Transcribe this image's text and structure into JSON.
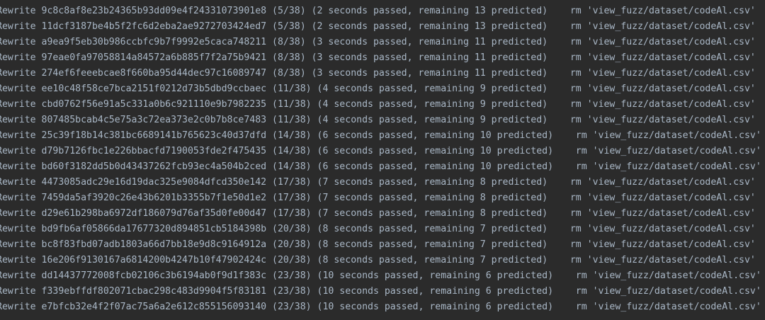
{
  "terminal": {
    "lines": [
      "Rewrite 9c8c8af8e23b24365b93dd09e4f24331073901e8 (5/38) (2 seconds passed, remaining 13 predicted)    rm 'view_fuzz/dataset/codeAl.csv'",
      "Rewrite 11dcf3187be4b5f2fc6d2eba2ae9272703424ed7 (5/38) (2 seconds passed, remaining 13 predicted)    rm 'view_fuzz/dataset/codeAl.csv'",
      "Rewrite a9ea9f5eb30b986ccbfc9b7f9992e5caca748211 (8/38) (3 seconds passed, remaining 11 predicted)    rm 'view_fuzz/dataset/codeAl.csv'",
      "Rewrite 97eae0fa97058814a84572a6b885f7f2a75b9421 (8/38) (3 seconds passed, remaining 11 predicted)    rm 'view_fuzz/dataset/codeAl.csv'",
      "Rewrite 274ef6feeebcae8f660ba95d44dec97c16089747 (8/38) (3 seconds passed, remaining 11 predicted)    rm 'view_fuzz/dataset/codeAl.csv'",
      "Rewrite ee10c48f58ce7bca2151f0212d73b5dbd9ccbaec (11/38) (4 seconds passed, remaining 9 predicted)    rm 'view_fuzz/dataset/codeAl.csv'",
      "Rewrite cbd0762f56e91a5c331a0b6c921110e9b7982235 (11/38) (4 seconds passed, remaining 9 predicted)    rm 'view_fuzz/dataset/codeAl.csv'",
      "Rewrite 807485bcab4c5e75a3c72ea373e2c0b7b8ce7483 (11/38) (4 seconds passed, remaining 9 predicted)    rm 'view_fuzz/dataset/codeAl.csv'",
      "Rewrite 25c39f18b14c381bc6689141b765623c40d37dfd (14/38) (6 seconds passed, remaining 10 predicted)    rm 'view_fuzz/dataset/codeAl.csv'",
      "Rewrite d79b7126fbc1e226bbacfd7190053fde2f475435 (14/38) (6 seconds passed, remaining 10 predicted)    rm 'view_fuzz/dataset/codeAl.csv'",
      "Rewrite bd60f3182dd5b0d43437262fcb93ec4a504b2ced (14/38) (6 seconds passed, remaining 10 predicted)    rm 'view_fuzz/dataset/codeAl.csv'",
      "Rewrite 4473085adc29e16d19dac325e9084dfcd350e142 (17/38) (7 seconds passed, remaining 8 predicted)    rm 'view_fuzz/dataset/codeAl.csv'",
      "Rewrite 7459da5af3920c26e43b6201b3355b7f1e50d1e2 (17/38) (7 seconds passed, remaining 8 predicted)    rm 'view_fuzz/dataset/codeAl.csv'",
      "Rewrite d29e61b298ba6972df186079d76af35d0fe00d47 (17/38) (7 seconds passed, remaining 8 predicted)    rm 'view_fuzz/dataset/codeAl.csv'",
      "Rewrite bd9fb6af05866da17677320d894851cb5184398b (20/38) (8 seconds passed, remaining 7 predicted)    rm 'view_fuzz/dataset/codeAl.csv'",
      "Rewrite bc8f83fbd07adb1803a66d7bb18e9d8c9164912a (20/38) (8 seconds passed, remaining 7 predicted)    rm 'view_fuzz/dataset/codeAl.csv'",
      "Rewrite 16e206f9130167a6814200b4247b10f47902424c (20/38) (8 seconds passed, remaining 7 predicted)    rm 'view_fuzz/dataset/codeAl.csv'",
      "Rewrite dd14437772008fcb02106c3b6194ab0f9d1f383c (23/38) (10 seconds passed, remaining 6 predicted)    rm 'view_fuzz/dataset/codeAl.csv'",
      "Rewrite f339ebffdf802071cbac298c483d9904f5f83181 (23/38) (10 seconds passed, remaining 6 predicted)    rm 'view_fuzz/dataset/codeAl.csv'",
      "Rewrite e7bfcb32e4f2f07ac75a6a2e612c855156093140 (23/38) (10 seconds passed, remaining 6 predicted)    rm 'view_fuzz/dataset/codeAl.csv'"
    ]
  },
  "colors": {
    "background": "#2b2b2b",
    "text": "#a9b7c6"
  }
}
